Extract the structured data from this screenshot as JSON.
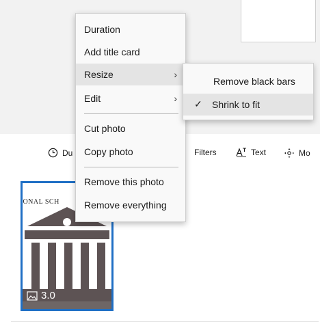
{
  "toolbar": {
    "duration_label": "Du",
    "filters_label": "Filters",
    "text_label": "Text",
    "motion_label": "Mo"
  },
  "storyboard": {
    "tile_caption": "TIONAL SCH",
    "tile_duration": "3.0",
    "tile_icon": "building-icon"
  },
  "context_menu": {
    "items": [
      "Duration",
      "Add title card",
      "Resize",
      "Edit",
      "Cut photo",
      "Copy photo",
      "Remove this photo",
      "Remove everything"
    ],
    "highlighted": "Resize"
  },
  "resize_submenu": {
    "items": [
      "Remove black bars",
      "Shrink to fit"
    ],
    "checked": "Shrink to fit"
  },
  "colors": {
    "accent": "#1f6fc5",
    "highlight": "#e4e4e4",
    "menu_bg": "#f9f9f9",
    "building": "#5d5354"
  }
}
